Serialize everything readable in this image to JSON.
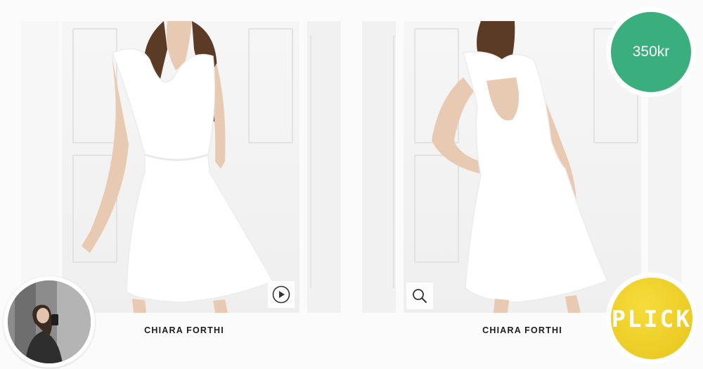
{
  "products": [
    {
      "brand": "CHIARA FORTHI",
      "media_action": "play-icon"
    },
    {
      "brand": "CHIARA FORTHI",
      "media_action": "search-icon"
    }
  ],
  "price_badge": {
    "label": "350kr",
    "color": "#3aaf7d"
  },
  "cta": {
    "label": "PLICK",
    "color": "#e8c41c"
  },
  "seller_avatar": {
    "icon": "avatar"
  }
}
